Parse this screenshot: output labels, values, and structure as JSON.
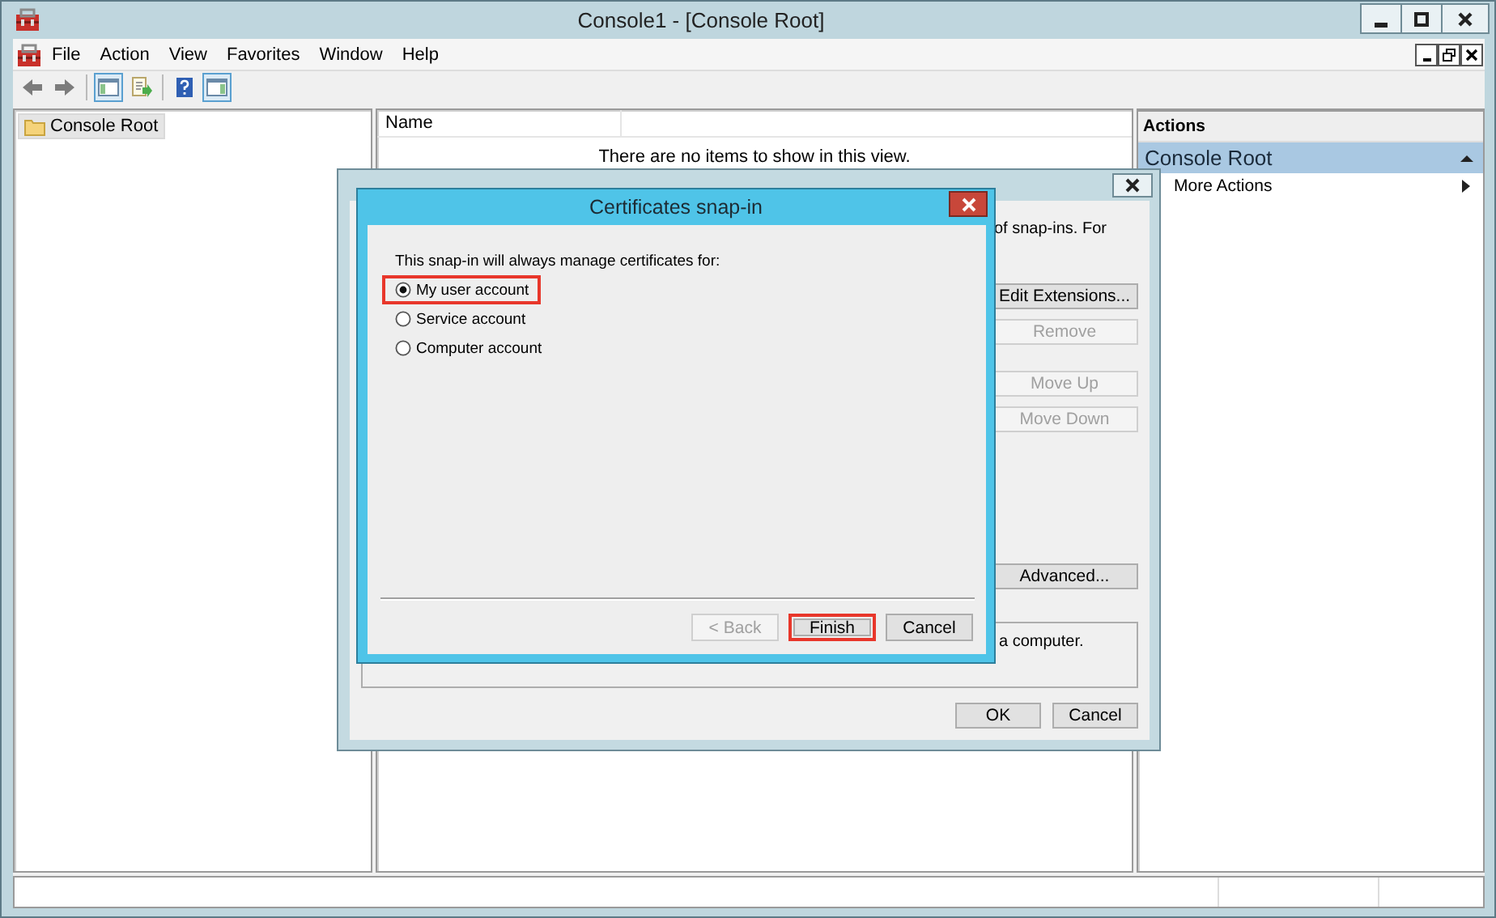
{
  "window": {
    "title": "Console1 - [Console Root]"
  },
  "menu": [
    {
      "label": "File"
    },
    {
      "label": "Action"
    },
    {
      "label": "View"
    },
    {
      "label": "Favorites"
    },
    {
      "label": "Window"
    },
    {
      "label": "Help"
    }
  ],
  "tree": {
    "items": [
      {
        "label": "Console Root",
        "selected": true
      }
    ]
  },
  "list": {
    "columns": [
      "Name"
    ],
    "empty_text": "There are no items to show in this view."
  },
  "actions": {
    "title": "Actions",
    "sections": [
      {
        "label": "Console Root",
        "expanded": true,
        "items": [
          {
            "label": "More Actions",
            "submenu": true
          }
        ]
      }
    ]
  },
  "snapins_dialog": {
    "text_fragment": "of snap-ins. For",
    "buttons": [
      {
        "label": "Edit Extensions...",
        "disabled": false
      },
      {
        "label": "Remove",
        "disabled": true
      },
      {
        "label": "Move Up",
        "disabled": true
      },
      {
        "label": "Move Down",
        "disabled": true
      },
      {
        "label": "Advanced...",
        "disabled": false
      }
    ],
    "description": "a computer.",
    "footer_buttons": [
      {
        "label": "OK"
      },
      {
        "label": "Cancel"
      }
    ]
  },
  "wizard": {
    "title": "Certificates snap-in",
    "prompt": "This snap-in will always manage certificates for:",
    "options": [
      {
        "label": "My user account",
        "selected": true,
        "highlighted": true
      },
      {
        "label": "Service account",
        "selected": false,
        "highlighted": false
      },
      {
        "label": "Computer account",
        "selected": false,
        "highlighted": false
      }
    ],
    "buttons": [
      {
        "label": "< Back",
        "disabled": true,
        "highlighted": false
      },
      {
        "label": "Finish",
        "disabled": false,
        "highlighted": true
      },
      {
        "label": "Cancel",
        "disabled": false,
        "highlighted": false
      }
    ]
  }
}
